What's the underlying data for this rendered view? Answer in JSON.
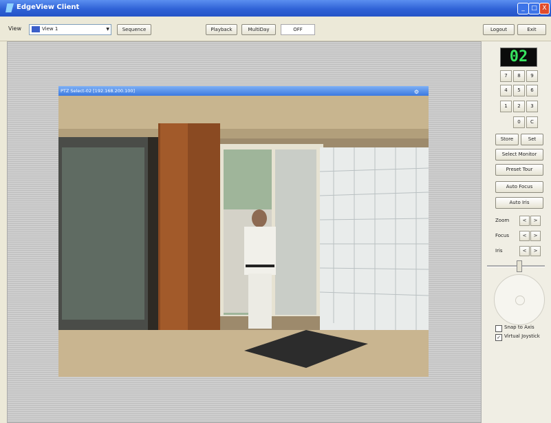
{
  "window": {
    "title": "EdgeView Client",
    "minimize": "_",
    "maximize": "□",
    "close": "X"
  },
  "toolbar": {
    "view_label": "View",
    "view_value": "View 1",
    "sequence": "Sequence",
    "playback": "Playback",
    "multiday": "MultiDay",
    "field_value": "OFF",
    "logout": "Logout",
    "exit": "Exit"
  },
  "camera": {
    "title": "PTZ Select-02 [192.168.200.100]"
  },
  "panel": {
    "monitor_number": "02",
    "keypad": [
      "7",
      "8",
      "9",
      "4",
      "5",
      "6",
      "1",
      "2",
      "3",
      "0",
      "C"
    ],
    "store": "Store",
    "set": "Set",
    "select_monitor": "Select Monitor",
    "preset_tour": "Preset Tour",
    "auto_focus": "Auto Focus",
    "auto_iris": "Auto Iris",
    "zoom": "Zoom",
    "focus": "Focus",
    "iris": "Iris",
    "minus": "<",
    "plus": ">",
    "snap_to_axis": "Snap to Axis",
    "virtual_joystick": "Virtual Joystick",
    "virtual_joystick_checked": "✓"
  }
}
